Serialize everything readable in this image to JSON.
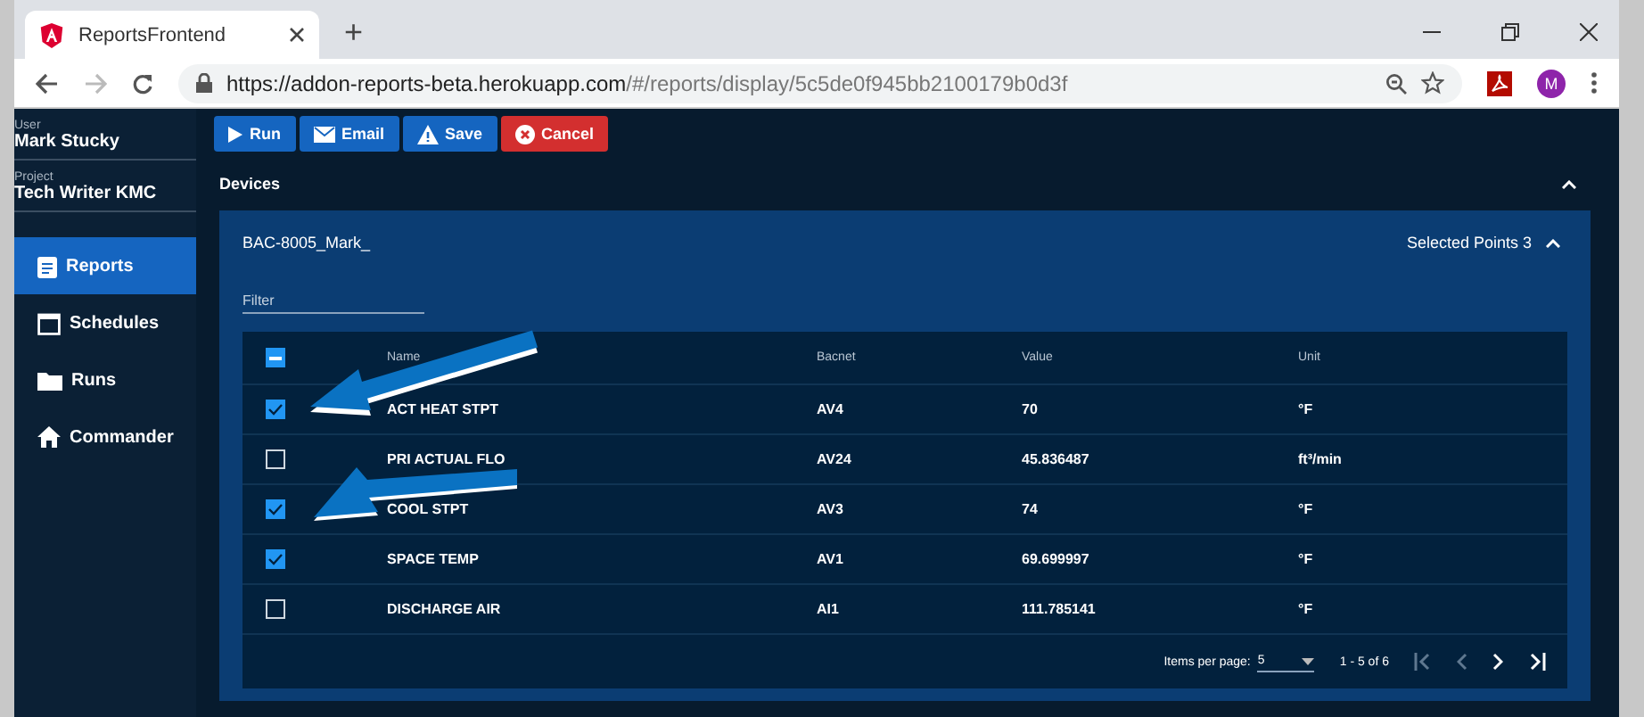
{
  "browser": {
    "tab_title": "ReportsFrontend",
    "new_tab": "+",
    "url_host": "https://addon-reports-beta.herokuapp.com",
    "url_path": "/#/reports/display/5c5de0f945bb2100179b0d3f",
    "avatar": "M"
  },
  "sidebar": {
    "user_label": "User",
    "user": "Mark Stucky",
    "project_label": "Project",
    "project": "Tech Writer KMC",
    "items": [
      {
        "label": "Reports",
        "kind": "reports",
        "selected": true
      },
      {
        "label": "Schedules",
        "kind": "schedules",
        "selected": false
      },
      {
        "label": "Runs",
        "kind": "runs",
        "selected": false
      },
      {
        "label": "Commander",
        "kind": "commander",
        "selected": false
      }
    ]
  },
  "toolbar": [
    {
      "label": "Run",
      "kind": "run"
    },
    {
      "label": "Email",
      "kind": "email"
    },
    {
      "label": "Save",
      "kind": "save"
    },
    {
      "label": "Cancel",
      "kind": "cancel"
    }
  ],
  "devices": {
    "title": "Devices",
    "expanded": true,
    "device": {
      "name": "BAC-8005_Mark_",
      "selected_points": "Selected Points 3",
      "expanded": true,
      "filter_placeholder": "Filter"
    }
  },
  "table": {
    "select_all_indeterminate": true,
    "columns": [
      "Name",
      "Bacnet",
      "Value",
      "Unit"
    ],
    "rows": [
      {
        "checked": true,
        "cells": [
          "ACT HEAT STPT",
          "AV4",
          "70",
          "°F"
        ]
      },
      {
        "checked": false,
        "cells": [
          "PRI ACTUAL FLO",
          "AV24",
          "45.836487",
          "ft³/min"
        ]
      },
      {
        "checked": true,
        "cells": [
          "COOL STPT",
          "AV3",
          "74",
          "°F"
        ]
      },
      {
        "checked": true,
        "cells": [
          "SPACE TEMP",
          "AV1",
          "69.699997",
          "°F"
        ]
      },
      {
        "checked": false,
        "cells": [
          "DISCHARGE AIR",
          "AI1",
          "111.785141",
          "°F"
        ]
      }
    ]
  },
  "paginator": {
    "label": "Items per page:",
    "page_size": "5",
    "range": "1 - 5 of 6"
  }
}
